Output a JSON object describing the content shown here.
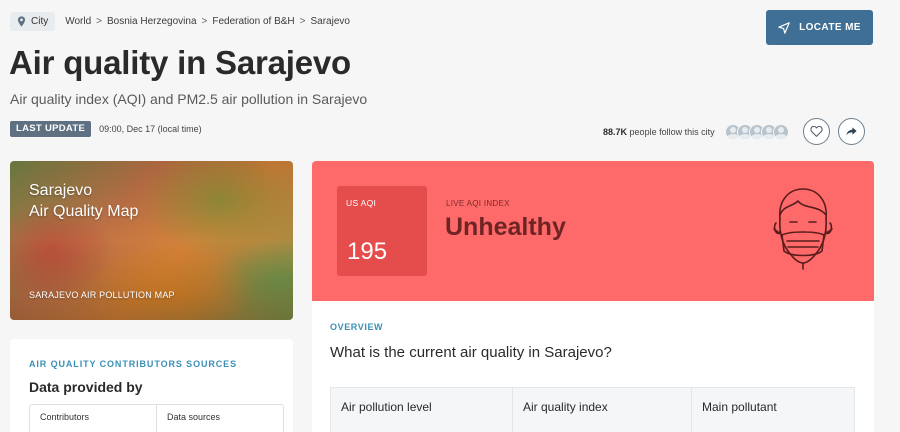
{
  "breadcrumb": {
    "chip_label": "City",
    "items": [
      "World",
      "Bosnia Herzegovina",
      "Federation of B&H",
      "Sarajevo"
    ],
    "separator": ">"
  },
  "locate_button": {
    "label": "LOCATE ME"
  },
  "header": {
    "title": "Air quality in Sarajevo",
    "subtitle": "Air quality index (AQI) and PM2.5 air pollution in Sarajevo"
  },
  "last_update": {
    "badge": "LAST UPDATE",
    "time": "09:00, Dec 17 (local time)"
  },
  "followers": {
    "count": "88.7K",
    "text": "people follow this city",
    "avatar_count": 5
  },
  "map_card": {
    "title_line1": "Sarajevo",
    "title_line2": "Air Quality Map",
    "link": "SARAJEVO AIR POLLUTION MAP"
  },
  "sources": {
    "heading": "AIR QUALITY CONTRIBUTORS SOURCES",
    "subheading": "Data provided by",
    "columns": [
      "Contributors",
      "Data sources"
    ]
  },
  "aqi": {
    "box_label": "US AQI",
    "value": "195",
    "live_label": "LIVE AQI INDEX",
    "status": "Unhealthy",
    "panel_color": "#fe6a6a",
    "box_color": "#e54c4c",
    "status_color": "#6f2424",
    "icon": "face-mask-icon"
  },
  "overview": {
    "label": "OVERVIEW",
    "question": "What is the current air quality in Sarajevo?",
    "table_headers": [
      "Air pollution level",
      "Air quality index",
      "Main pollutant"
    ]
  },
  "colors": {
    "accent": "#3f6f95",
    "link_blue": "#3b8fb6",
    "badge": "#5e7082"
  }
}
